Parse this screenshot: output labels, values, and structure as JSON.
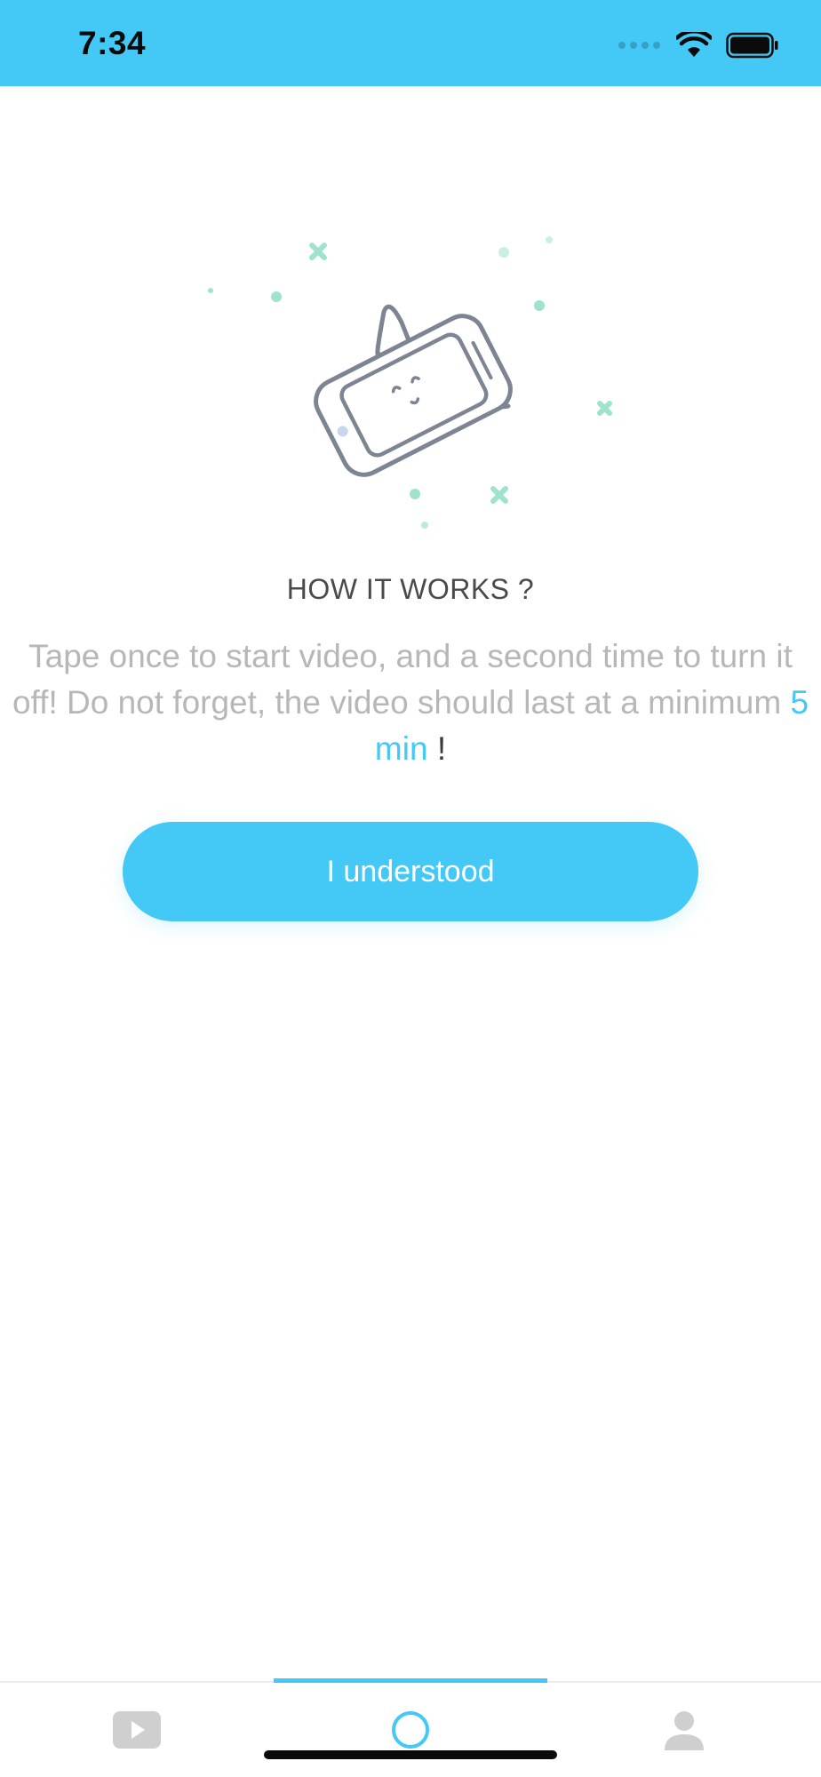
{
  "status_bar": {
    "time": "7:34",
    "signal_icon": "cellular-signal-icon",
    "wifi_icon": "wifi-icon",
    "battery_icon": "battery-icon"
  },
  "illustration": {
    "icon": "tilted-phone-illustration"
  },
  "info": {
    "title": "HOW IT WORKS ?",
    "description_prefix": "Tape once to start video, and a second time to turn it off! Do not forget, the video should last at a minimum ",
    "description_highlight": "5 min",
    "description_suffix": "!"
  },
  "actions": {
    "understood_label": "I understood"
  },
  "tab_bar": {
    "tabs": [
      {
        "icon": "play-video-icon",
        "active": false
      },
      {
        "icon": "record-circle-icon",
        "active": true
      },
      {
        "icon": "profile-icon",
        "active": false
      }
    ]
  },
  "colors": {
    "accent": "#44C8F5",
    "illustration_stroke": "#7d8593",
    "sparkle": "#9fe3cf"
  }
}
